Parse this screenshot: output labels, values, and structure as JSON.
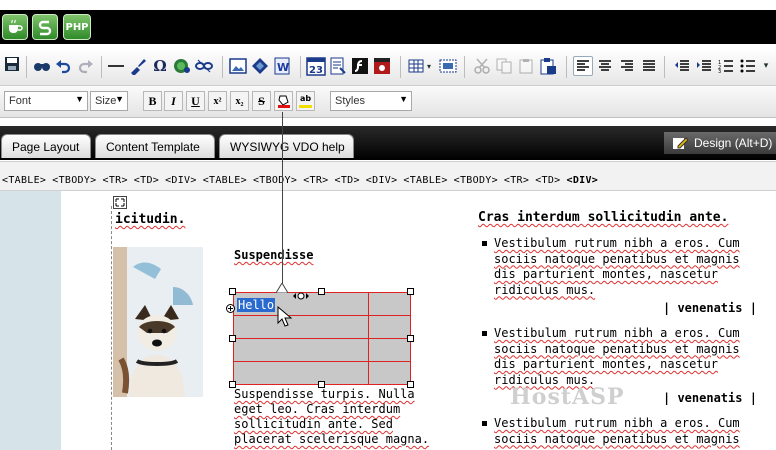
{
  "app": {
    "icons": [
      "coffee-icon",
      "s-logo-icon",
      "php-icon"
    ],
    "php_label": "PHP"
  },
  "toolbar2": {
    "font_label": "Font",
    "size_label": "Size",
    "bold": "B",
    "italic": "I",
    "underline": "U",
    "superscript": "x²",
    "subscript": "x₂",
    "strike": "S",
    "highlight": "ab",
    "styles_label": "Styles"
  },
  "tabs": [
    {
      "label": "Page Layout"
    },
    {
      "label": "Content Template"
    },
    {
      "label": "WYSIWYG VDO help"
    }
  ],
  "design_tab": {
    "label": "Design (Alt+D)"
  },
  "breadcrumb": [
    "<TABLE>",
    "<TBODY>",
    "<TR>",
    "<TD>",
    "<DIV>",
    "<TABLE>",
    "<TBODY>",
    "<TR>",
    "<TD>",
    "<DIV>",
    "<TABLE>",
    "<TBODY>",
    "<TR>",
    "<TD>",
    "<DIV>"
  ],
  "content": {
    "heading_left": "icitudin.",
    "suspendisse_heading": "Suspendisse",
    "cell_text": "Hello",
    "para_lines": [
      "Suspendisse turpis. Nulla",
      "eget leo. Cras interdum",
      "sollicitudin ante. Sed",
      "placerat scelerisque magna."
    ],
    "right_heading": "Cras interdum sollicitudin ante.",
    "bullets": [
      {
        "lines": [
          "Vestibulum rutrum nibh a eros. Cum",
          "sociis natoque penatibus et magnis",
          "dis parturient montes, nascetur",
          "ridiculus mus."
        ],
        "tag": "| venenatis |"
      },
      {
        "lines": [
          "Vestibulum rutrum nibh a eros. Cum",
          "sociis natoque penatibus et magnis",
          "dis parturient montes, nascetur",
          "ridiculus mus."
        ],
        "tag": "| venenatis |"
      },
      {
        "lines": [
          "Vestibulum rutrum nibh a eros. Cum",
          "sociis natoque penatibus et magnis"
        ]
      }
    ],
    "watermark": "HostASP"
  },
  "colors": {
    "accent_green": "#3a9a30",
    "selection_red": "#dd2222",
    "sidebar_blue": "#d6e4e9"
  }
}
